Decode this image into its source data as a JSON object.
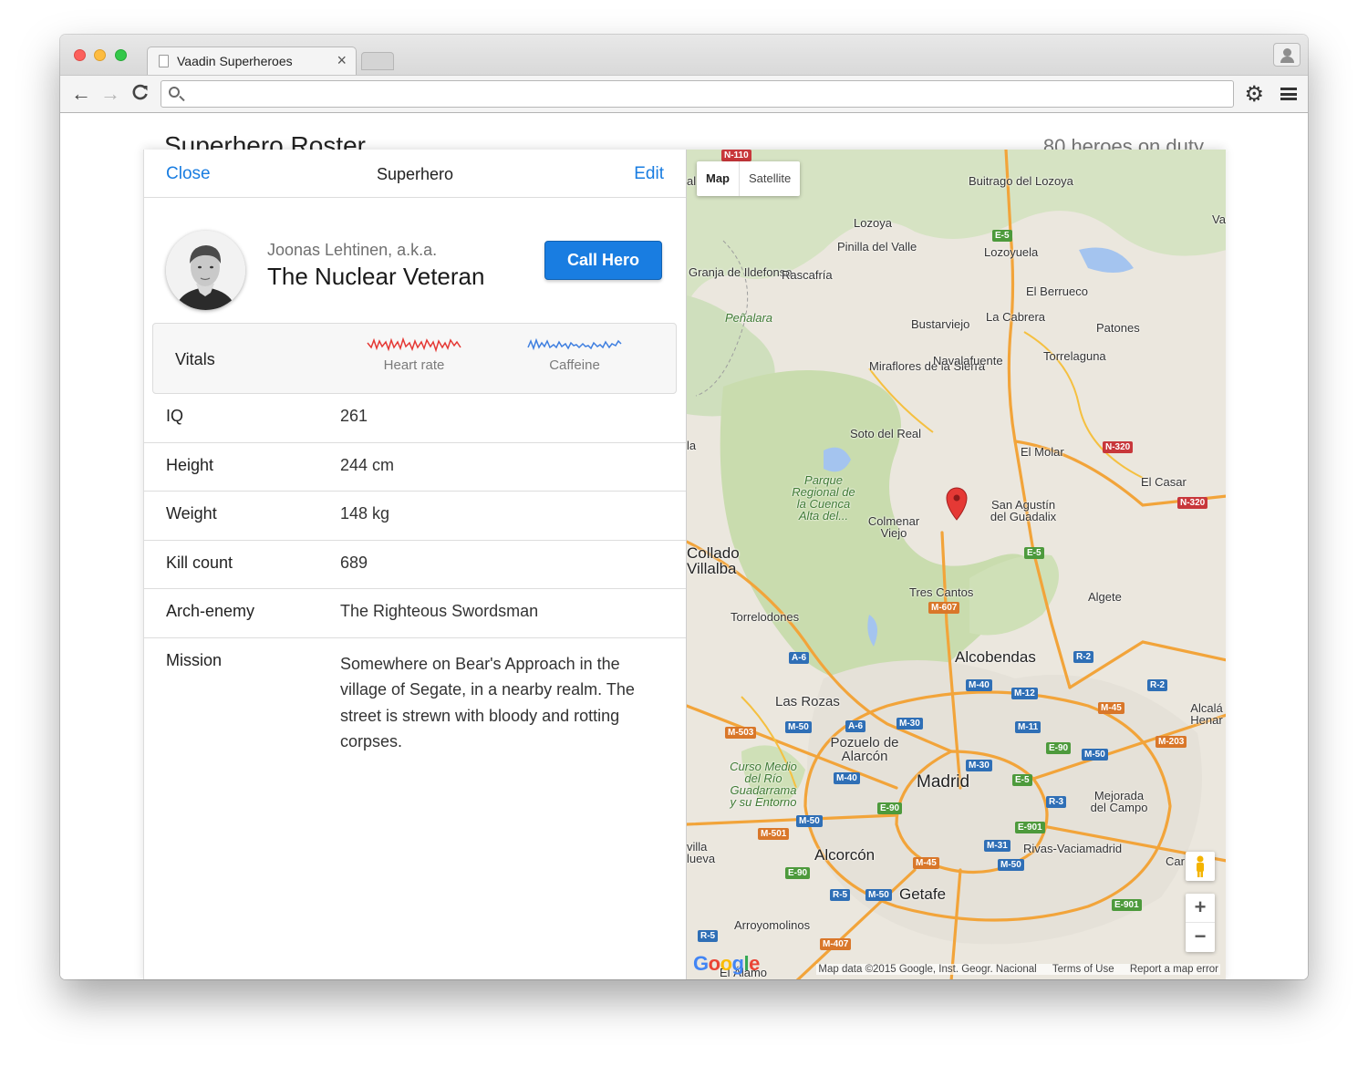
{
  "browser": {
    "tab_title": "Vaadin Superheroes",
    "tab_close": "×",
    "address_value": "",
    "back": "←",
    "forward": "→",
    "reload": "C",
    "settings": "⚙"
  },
  "page": {
    "roster_title": "Superhero Roster",
    "roster_count": "80 heroes on duty"
  },
  "detail": {
    "close_label": "Close",
    "title": "Superhero",
    "edit_label": "Edit",
    "real_name": "Joonas Lehtinen, a.k.a.",
    "hero_name": "The Nuclear Veteran",
    "call_label": "Call Hero",
    "vitals": {
      "label": "Vitals",
      "heart_rate_label": "Heart rate",
      "heart_rate_color": "#e53935",
      "caffeine_label": "Caffeine",
      "caffeine_color": "#3f7fe0"
    },
    "fields": [
      {
        "label": "IQ",
        "value": "261"
      },
      {
        "label": "Height",
        "value": "244 cm"
      },
      {
        "label": "Weight",
        "value": "148 kg"
      },
      {
        "label": "Kill count",
        "value": "689"
      },
      {
        "label": "Arch-enemy",
        "value": "The Righteous Swordsman"
      },
      {
        "label": "Mission",
        "value": "Somewhere on Bear's Approach in the village of Segate, in a nearby realm. The street is strewn with bloody and rotting corpses."
      }
    ]
  },
  "map": {
    "map_type": "Map",
    "satellite_type": "Satellite",
    "zoom_in": "+",
    "zoom_out": "−",
    "logo": "Google",
    "attribution": "Map data ©2015 Google, Inst. Geogr. Nacional",
    "terms": "Terms of Use",
    "report": "Report a map error",
    "places": {
      "buitrago": "Buitrago del Lozoya",
      "lozoya": "Lozoya",
      "pinilla": "Pinilla del Valle",
      "lozoyuela": "Lozoyuela",
      "granja": "Granja de Ildefonso",
      "rascafria": "Rascafría",
      "berrueco": "El Berrueco",
      "penalara": "Peñalara",
      "bustarviejo": "Bustarviejo",
      "cabrera": "La Cabrera",
      "patones": "Patones",
      "miraflores": "Miraflores de la Sierra",
      "navalafuente": "Navalafuente",
      "torrelaguna": "Torrelaguna",
      "soto": "Soto del Real",
      "molar": "El Molar",
      "parque": "Parque Regional de la Cuenca Alta del...",
      "casar": "El Casar",
      "colmenar": "Colmenar Viejo",
      "san_agustin": "San Agustín del Guadalix",
      "collado": "Collado Villalba",
      "tres_cantos": "Tres Cantos",
      "algete": "Algete",
      "torrelodones": "Torrelodones",
      "alcobendas": "Alcobendas",
      "las_rozas": "Las Rozas",
      "alcala": "Alcalá Henar",
      "pozuelo": "Pozuelo de Alarcón",
      "curso": "Curso Medio del Río Guadarrama y su Entorno",
      "madrid": "Madrid",
      "mejorada": "Mejorada del Campo",
      "rivas": "Rivas-Vaciamadrid",
      "alcorcon": "Alcorcón",
      "villa": "villa lueva",
      "getafe": "Getafe",
      "arroyomolinos": "Arroyomolinos",
      "va": "Va",
      "la": "la",
      "al": "al",
      "car": "Car",
      "el_alamo": "El Álamo"
    },
    "roads": {
      "n110": "N-110",
      "e5": "E-5",
      "n320": "N-320",
      "m607": "M-607",
      "a6": "A-6",
      "r2": "R-2",
      "m40": "M-40",
      "m12": "M-12",
      "m45": "M-45",
      "m503": "M-503",
      "m50": "M-50",
      "m30": "M-30",
      "m11": "M-11",
      "e90": "E-90",
      "m203": "M-203",
      "m501": "M-501",
      "r3": "R-3",
      "e901": "E-901",
      "m31": "M-31",
      "r5": "R-5",
      "m407": "M-407"
    }
  }
}
